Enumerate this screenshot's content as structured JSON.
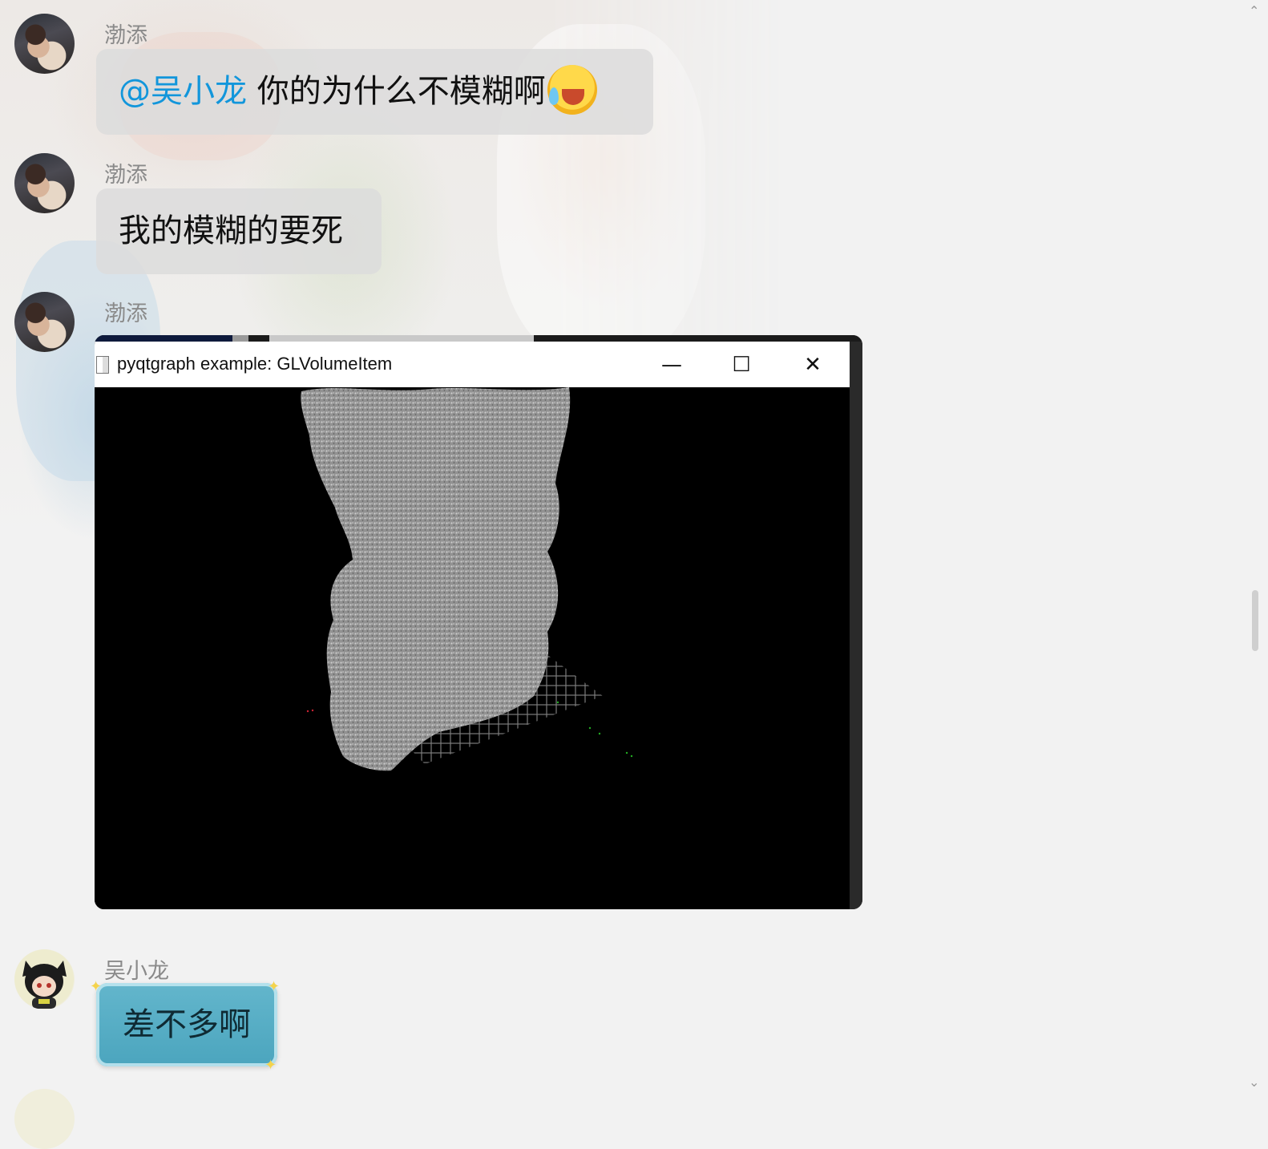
{
  "messages": [
    {
      "sender": "渤添",
      "mention": "@吴小龙",
      "text": " 你的为什么不模糊啊",
      "emoji": "crying-laughing-emoji"
    },
    {
      "sender": "渤添",
      "text": "我的模糊的要死"
    },
    {
      "sender": "渤添",
      "image": {
        "window_title": "pyqtgraph example: GLVolumeItem",
        "minimize_glyph": "—",
        "maximize_glyph": "☐",
        "close_glyph": "✕",
        "content": "3D volume rendering of a torso with grid"
      }
    },
    {
      "sender": "吴小龙",
      "text": "差不多啊"
    }
  ],
  "colors": {
    "mention": "#1296db",
    "bubble": "#dcdcdc",
    "teal_bubble": "#4ba5be",
    "background": "#f2f2f2"
  },
  "icons": {
    "scroll_top": "chevron-up-icon",
    "scroll_bottom": "chevron-down-icon"
  },
  "glyphs": {
    "corner_top": "⌃",
    "corner_bottom": "⌄"
  }
}
